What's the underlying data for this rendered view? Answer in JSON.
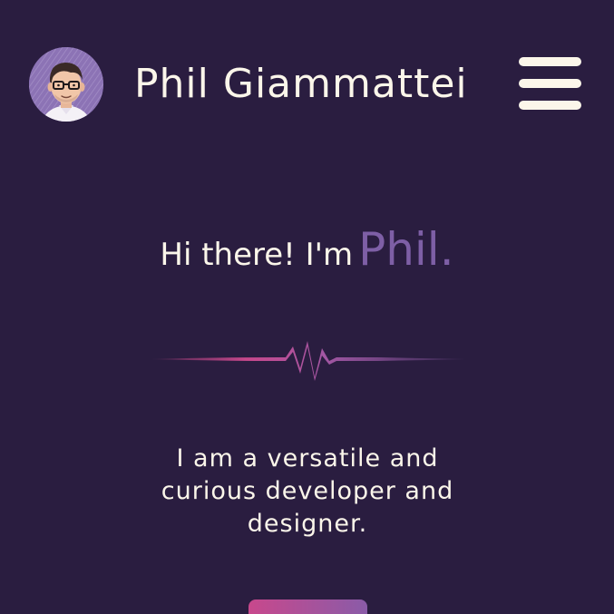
{
  "header": {
    "site_title": "Phil Giammattei",
    "avatar_icon": "avatar-portrait-icon",
    "menu_icon": "hamburger-menu-icon"
  },
  "hero": {
    "greeting_prefix": "Hi there! I'm",
    "greeting_name": "Phil.",
    "divider_icon": "heartbeat-divider-icon",
    "tagline": "I am a versatile and curious developer and designer."
  },
  "colors": {
    "background": "#2a1d40",
    "text": "#fbf6ea",
    "accent_purple": "#7e5fa6",
    "accent_pink": "#c8488c"
  }
}
